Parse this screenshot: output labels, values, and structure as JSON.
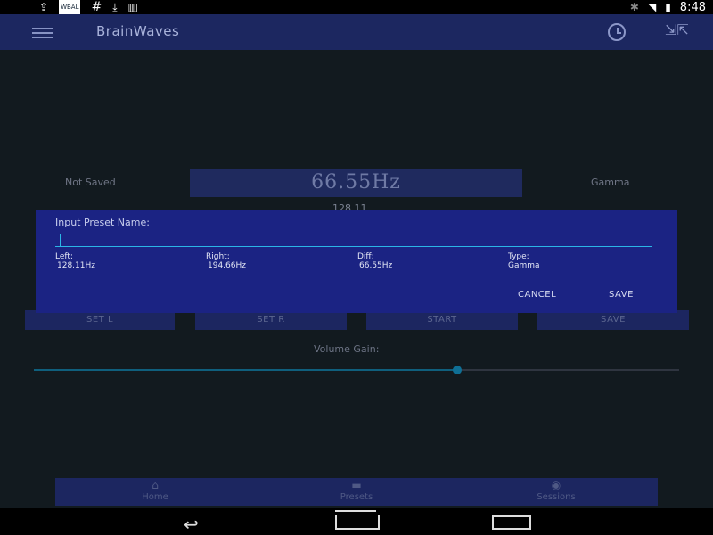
{
  "statusbar": {
    "left_icons": [
      "upload-icon",
      "wbal-icon",
      "hash-icon",
      "download-icon",
      "barcode-icon"
    ],
    "hash_text": "#",
    "wbal_text": "WBAL",
    "time": "8:48"
  },
  "appbar": {
    "title": "BrainWaves"
  },
  "main": {
    "status_left": "Not Saved",
    "frequency": "66.55Hz",
    "wave_type": "Gamma",
    "sub_value": "128.11",
    "buttons": [
      "SET L",
      "SET R",
      "START",
      "SAVE"
    ],
    "volume_label": "Volume Gain:",
    "volume_fraction": 0.656
  },
  "dialog": {
    "title": "Input Preset Name:",
    "input_value": "",
    "left_label": "Left:",
    "left_value": "128.11Hz",
    "right_label": "Right:",
    "right_value": "194.66Hz",
    "diff_label": "Diff:",
    "diff_value": "66.55Hz",
    "type_label": "Type:",
    "type_value": "Gamma",
    "cancel_label": "CANCEL",
    "save_label": "SAVE"
  },
  "bottomnav": {
    "items": [
      {
        "label": "Home",
        "icon": "home-icon"
      },
      {
        "label": "Presets",
        "icon": "presets-icon"
      },
      {
        "label": "Sessions",
        "icon": "sessions-icon"
      }
    ]
  },
  "colors": {
    "appbar": "#1c2760",
    "dialog": "#1b2383",
    "accent": "#2bb6e6",
    "background": "#121a1f"
  }
}
